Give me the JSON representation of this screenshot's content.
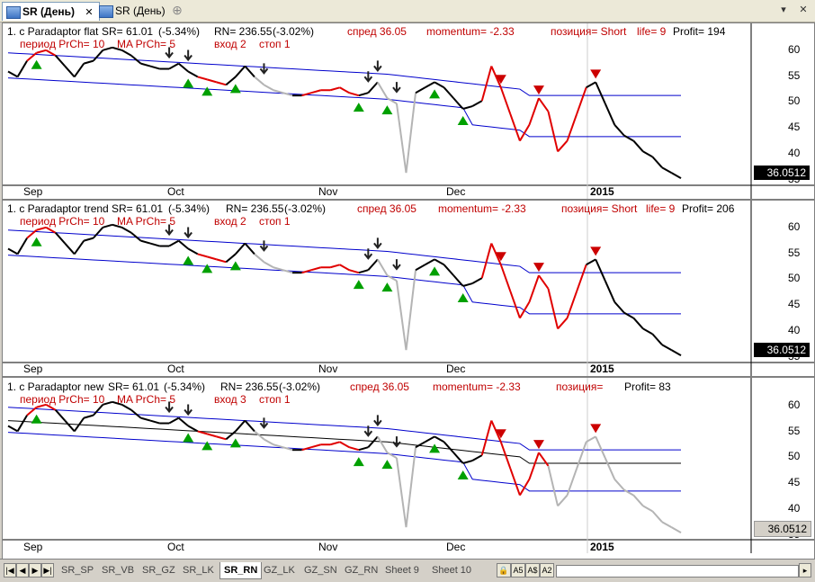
{
  "tabs": [
    {
      "label": "SR (День)",
      "active": true,
      "close": "✕"
    },
    {
      "label": "SR (День)",
      "active": false
    }
  ],
  "window": {
    "restore": "▾",
    "close": "✕"
  },
  "panes": [
    {
      "name": "flat",
      "line1": {
        "title": "1. c Paradaptor flat",
        "sr": "SR= 61.01",
        "sr_pct": "(-5.34%)",
        "rn": "RN= 236.55",
        "rn_pct": "(-3.02%)",
        "spread": "спред 36.05",
        "momentum": "momentum=  -2.33",
        "position": "позиция= Short",
        "life": "life= 9",
        "profit": "Profit= 194"
      },
      "line2": {
        "period": "период PrCh= 10",
        "ma": "MA PrCh= 5",
        "entry": "вход 2",
        "stop": "стоп 1"
      },
      "last_value": "36.0512"
    },
    {
      "name": "trend",
      "line1": {
        "title": "1. c Paradaptor trend",
        "sr": "SR= 61.01",
        "sr_pct": "(-5.34%)",
        "rn": "RN= 236.55",
        "rn_pct": "(-3.02%)",
        "spread": "спред 36.05",
        "momentum": "momentum=  -2.33",
        "position": "позиция= Short",
        "life": "life= 9",
        "profit": "Profit= 206"
      },
      "line2": {
        "period": "период PrCh= 10",
        "ma": "MA PrCh= 5",
        "entry": "вход 2",
        "stop": "стоп 1"
      },
      "last_value": "36.0512"
    },
    {
      "name": "new",
      "line1": {
        "title": "1. c Paradaptor new",
        "sr": "SR= 61.01",
        "sr_pct": "(-5.34%)",
        "rn": "RN= 236.55",
        "rn_pct": "(-3.02%)",
        "spread": "спред 36.05",
        "momentum": "momentum=  -2.33",
        "position": "позиция=",
        "life": "",
        "profit": "Profit= 83"
      },
      "line2": {
        "period": "период PrCh= 10",
        "ma": "MA PrCh= 5",
        "entry": "вход 3",
        "stop": "стоп 1"
      },
      "last_value": "36.0512"
    }
  ],
  "y_ticks": [
    "60",
    "55",
    "50",
    "45",
    "40",
    "35"
  ],
  "x_labels": [
    "Sep",
    "Oct",
    "Nov",
    "Dec",
    "2015"
  ],
  "sheets": [
    "SR_SP",
    "SR_VB",
    "SR_GZ",
    "SR_LK",
    "SR_RN",
    "GZ_LK",
    "GZ_SN",
    "GZ_RN",
    "Sheet 9",
    "Sheet 10"
  ],
  "active_sheet": "SR_RN",
  "nav": [
    "|◀",
    "◀",
    "▶",
    "▶|"
  ],
  "zoom_controls": [
    "🔒",
    "A5",
    "A$",
    "A2"
  ],
  "chart_data": {
    "type": "line",
    "ylim": [
      35,
      63
    ],
    "series": [
      {
        "values": [
          56,
          55,
          58,
          59.5,
          60,
          59,
          57,
          55,
          57.5,
          58,
          60,
          60.5,
          60,
          59,
          57.5,
          57,
          56.5,
          56.5,
          57.5,
          56,
          55,
          54.5,
          54,
          53.5,
          55,
          57,
          55,
          53.5,
          52.5,
          52,
          51.5,
          51.5,
          52,
          52.5,
          52.5,
          53,
          52,
          51.5,
          52,
          54,
          51,
          50,
          37,
          52,
          53,
          54,
          53,
          51,
          49,
          49.5,
          50.5,
          57,
          53,
          48,
          43,
          46,
          51,
          48.5,
          41,
          43,
          48,
          53,
          54,
          50,
          46,
          44,
          43,
          41,
          40,
          38,
          37,
          36
        ]
      }
    ]
  }
}
